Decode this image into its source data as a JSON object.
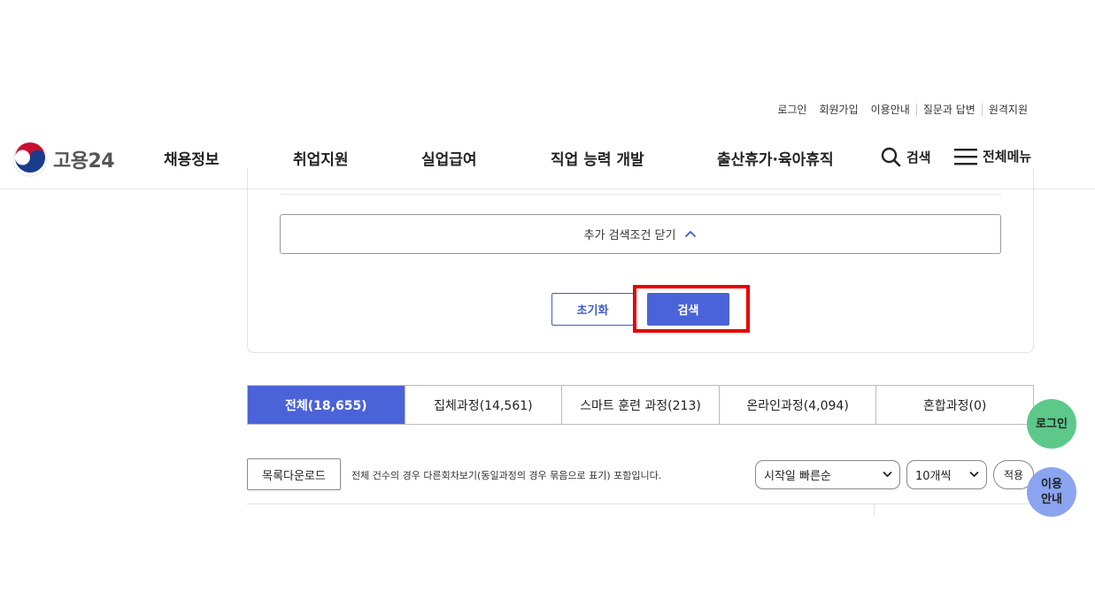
{
  "util_links": [
    "로그인",
    "회원가입",
    "이용안내",
    "질문과 답변",
    "원격지원"
  ],
  "logo": {
    "text": "고용24",
    "icon": "taegeuk-logo-icon"
  },
  "nav": [
    "채용정보",
    "취업지원",
    "실업급여",
    "직업 능력 개발",
    "출산휴가·육아휴직"
  ],
  "header_actions": {
    "search": "검색",
    "search_icon": "search-icon",
    "menu": "전체메뉴",
    "menu_icon": "hamburger-icon"
  },
  "search_panel": {
    "toggle_label": "추가 검색조건 닫기",
    "toggle_icon": "chevron-up-icon",
    "reset_label": "초기화",
    "search_label": "검색"
  },
  "tabs": [
    {
      "label": "전체(18,655)",
      "active": true
    },
    {
      "label": "집체과정(14,561)",
      "active": false
    },
    {
      "label": "스마트 훈련 과정(213)",
      "active": false
    },
    {
      "label": "온라인과정(4,094)",
      "active": false
    },
    {
      "label": "혼합과정(0)",
      "active": false
    }
  ],
  "list_toolbar": {
    "download_label": "목록다운로드",
    "notice": "전체 건수의 경우 다른회차보기(동일과정의 경우 묶음으로 표기) 포함입니다.",
    "sort_selected": "시작일 빠른순",
    "count_selected": "10개씩",
    "apply_label": "적용"
  },
  "floating": {
    "login": "로그인",
    "guide_line1": "이용",
    "guide_line2": "안내"
  },
  "colors": {
    "primary": "#4b63d9",
    "highlight": "#e60000",
    "login_float": "#5cc98a",
    "guide_float": "#8aa4f0"
  }
}
